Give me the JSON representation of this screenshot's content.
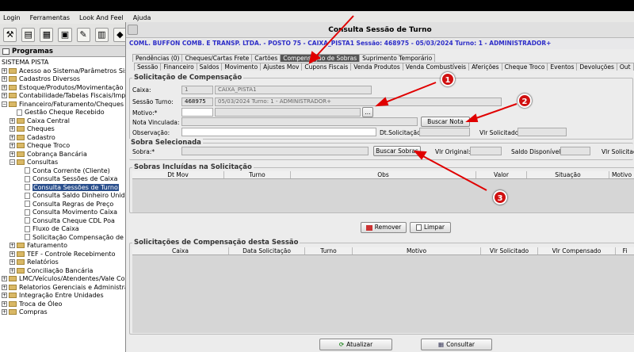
{
  "menubar": {
    "items": [
      "Login",
      "Ferramentas",
      "Look And Feel",
      "Ajuda"
    ]
  },
  "left_panel": {
    "title": "Programas",
    "root": "SISTEMA PISTA",
    "tree": [
      {
        "label": "Acesso ao Sistema/Parâmetros Sis",
        "level": 0,
        "type": "folder",
        "exp": "+"
      },
      {
        "label": "Cadastros Diversos",
        "level": 0,
        "type": "folder",
        "exp": "+"
      },
      {
        "label": "Estoque/Produtos/Movimentação",
        "level": 0,
        "type": "folder",
        "exp": "+"
      },
      {
        "label": "Contabilidade/Tabelas Fiscais/Impor",
        "level": 0,
        "type": "folder",
        "exp": "+"
      },
      {
        "label": "Financeiro/Faturamento/Cheques",
        "level": 0,
        "type": "folder",
        "exp": "−"
      },
      {
        "label": "Gestão Cheque Recebido",
        "level": 1,
        "type": "doc",
        "exp": ""
      },
      {
        "label": "Caixa Central",
        "level": 1,
        "type": "folder",
        "exp": "+"
      },
      {
        "label": "Cheques",
        "level": 1,
        "type": "folder",
        "exp": "+"
      },
      {
        "label": "Cadastro",
        "level": 1,
        "type": "folder",
        "exp": "+"
      },
      {
        "label": "Cheque Troco",
        "level": 1,
        "type": "folder",
        "exp": "+"
      },
      {
        "label": "Cobrança Bancária",
        "level": 1,
        "type": "folder",
        "exp": "+"
      },
      {
        "label": "Consultas",
        "level": 1,
        "type": "folder",
        "exp": "−"
      },
      {
        "label": "Conta Corrente (Cliente)",
        "level": 2,
        "type": "doc",
        "exp": ""
      },
      {
        "label": "Consulta Sessões de Caixa",
        "level": 2,
        "type": "doc",
        "exp": ""
      },
      {
        "label": "Consulta Sessões de Turno",
        "level": 2,
        "type": "doc",
        "exp": "",
        "selected": true
      },
      {
        "label": "Consulta Saldo Dinheiro Unid",
        "level": 2,
        "type": "doc",
        "exp": ""
      },
      {
        "label": "Consulta Regras de Preço",
        "level": 2,
        "type": "doc",
        "exp": ""
      },
      {
        "label": "Consulta Movimento Caixa",
        "level": 2,
        "type": "doc",
        "exp": ""
      },
      {
        "label": "Consulta Cheque CDL Poa",
        "level": 2,
        "type": "doc",
        "exp": ""
      },
      {
        "label": "Fluxo de Caixa",
        "level": 2,
        "type": "doc",
        "exp": ""
      },
      {
        "label": "Solicitação Compensação de",
        "level": 2,
        "type": "doc",
        "exp": ""
      },
      {
        "label": "Faturamento",
        "level": 1,
        "type": "folder",
        "exp": "+"
      },
      {
        "label": "TEF - Controle Recebimento",
        "level": 1,
        "type": "folder",
        "exp": "+"
      },
      {
        "label": "Relatórios",
        "level": 1,
        "type": "folder",
        "exp": "+"
      },
      {
        "label": "Conciliação Bancária",
        "level": 1,
        "type": "folder",
        "exp": "+"
      },
      {
        "label": "LMC/Veículos/Atendentes/Vale Com",
        "level": 0,
        "type": "folder",
        "exp": "+"
      },
      {
        "label": "Relatorios Gerenciais e Administrat",
        "level": 0,
        "type": "folder",
        "exp": "+"
      },
      {
        "label": "Integração Entre Unidades",
        "level": 0,
        "type": "folder",
        "exp": "+"
      },
      {
        "label": "Troca de Óleo",
        "level": 0,
        "type": "folder",
        "exp": "+"
      },
      {
        "label": "Compras",
        "level": 0,
        "type": "folder",
        "exp": "+"
      }
    ]
  },
  "dialog": {
    "title": "Consulta Sessão de Turno",
    "infobar": "COML. BUFFON COMB. E TRANSP. LTDA. - POSTO 75 - CAIXA_PISTA1   Sessão: 468975 - 05/03/2024 Turno: 1 - ADMINISTRADOR+",
    "tabs_row1": [
      "Pendências (0)",
      "Cheques/Cartas Frete",
      "Cartões",
      "Compensação de Sobras",
      "Suprimento Temporário"
    ],
    "tabs_row1_active": "Compensação de Sobras",
    "tabs_row2": [
      "Sessão",
      "Financeiro",
      "Saldos",
      "Movimento",
      "Ajustes Mov",
      "Cupons Fiscais",
      "Venda Produtos",
      "Venda Combustíveis",
      "Aferições",
      "Cheque Troco",
      "Eventos",
      "Devoluções",
      "Out"
    ],
    "solicitacao": {
      "title": "Solicitação de Compensação",
      "caixa_label": "Caixa:",
      "caixa_code": "1",
      "caixa_name": "CAIXA_PISTA1",
      "sessao_label": "Sessão Turno:",
      "sessao_code": "468975",
      "sessao_desc": "05/03/2024 Turno: 1 - ADMINISTRADOR+",
      "motivo_label": "Motivo:*",
      "motivo_btn": "...",
      "nota_label": "Nota Vinculada:",
      "buscar_nota": "Buscar Nota",
      "obs_label": "Observação:",
      "dt_label": "Dt.Solicitação:",
      "vlr_sol_label": "Vlr Solicitado:"
    },
    "sobra": {
      "title": "Sobra Selecionada",
      "sobra_label": "Sobra:*",
      "buscar_sobras": "Buscar Sobras",
      "vlr_original_label": "Vlr Original:",
      "saldo_label": "Saldo Disponível:",
      "vlr_solicitado_label": "Vlr Solicitado"
    },
    "sobras_incluidas": {
      "title": "Sobras Incluídas na Solicitação",
      "columns": [
        "Dt Mov",
        "Turno",
        "Obs",
        "Valor",
        "Situação",
        "Motivo"
      ],
      "remover": "Remover",
      "limpar": "Limpar"
    },
    "solicitacoes": {
      "title": "Solicitações de Compensação desta Sessão",
      "columns": [
        "Caixa",
        "Data Solicitação",
        "Turno",
        "Motivo",
        "Vlr Solicitado",
        "Vlr Compensado",
        "Fi"
      ]
    },
    "footer": {
      "atualizar": "Atualizar",
      "consultar": "Consultar"
    }
  },
  "annotations": {
    "badges": [
      "1",
      "2",
      "3"
    ],
    "color": "#e00000"
  }
}
